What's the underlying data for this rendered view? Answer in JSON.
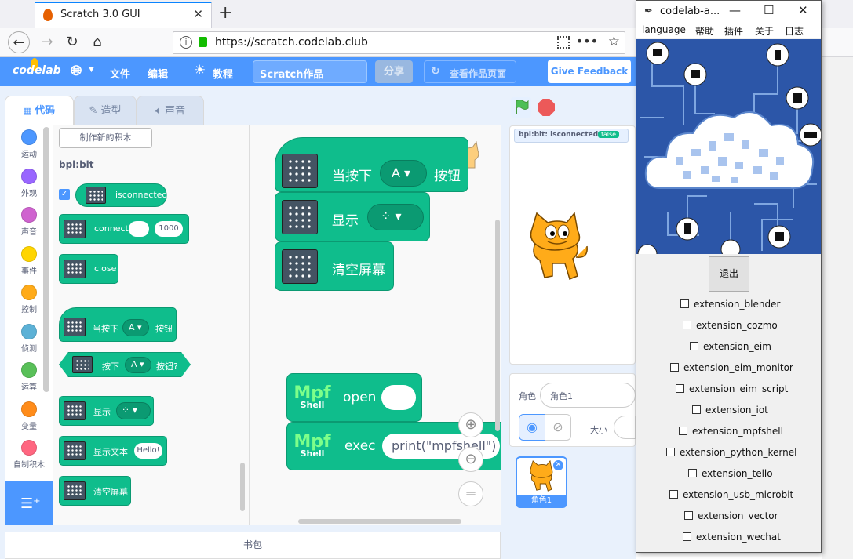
{
  "browser": {
    "tab_title": "Scratch 3.0 GUI",
    "tab_close": "✕",
    "new_tab": "+",
    "url": "https://scratch.codelab.club"
  },
  "menubar": {
    "logo": "codelab",
    "file": "文件",
    "edit": "编辑",
    "tutorials": "教程",
    "project_title": "Scratch作品",
    "share": "分享",
    "see_project": "查看作品页面",
    "feedback": "Give Feedback"
  },
  "editor_tabs": [
    "代码",
    "造型",
    "声音"
  ],
  "categories": [
    {
      "label": "运动",
      "color": "#4c97ff"
    },
    {
      "label": "外观",
      "color": "#9966ff"
    },
    {
      "label": "声音",
      "color": "#cf63cf"
    },
    {
      "label": "事件",
      "color": "#ffd500"
    },
    {
      "label": "控制",
      "color": "#ffab19"
    },
    {
      "label": "侦测",
      "color": "#5cb1d6"
    },
    {
      "label": "运算",
      "color": "#59c059"
    },
    {
      "label": "变量",
      "color": "#ff8c1a"
    },
    {
      "label": "自制积木",
      "color": "#ff6680"
    }
  ],
  "palette": {
    "make_block": "制作新的积木",
    "section": "bpi:bit",
    "isconnected": "isconnected",
    "connect": "connect",
    "connect_port": "1000",
    "close": "close",
    "when_pressed": "当按下",
    "when_pressed_key": "A",
    "button": "按钮",
    "pressed": "按下",
    "pressed_key": "A",
    "button_q": "按钮?",
    "show": "显示",
    "show_text": "显示文本",
    "show_text_value": "Hello!",
    "clear_screen": "清空屏幕"
  },
  "script": {
    "when_pressed": "当按下",
    "key": "A",
    "button": "按钮",
    "show": "显示",
    "clear_screen": "清空屏幕",
    "mpf": "Mpf",
    "shell": "Shell",
    "open": "open",
    "exec": "exec",
    "exec_value": "print(\"mpfshell\")"
  },
  "zoom": {
    "in": "⊕",
    "out": "⊖",
    "reset": "="
  },
  "backpack": "书包",
  "stage": {
    "monitor_label": "bpi:bit: isconnected",
    "monitor_value": "false"
  },
  "sprite": {
    "label": "角色",
    "name": "角色1",
    "size_label": "大小",
    "thumb_name": "角色1"
  },
  "popup": {
    "title": "codelab-a...",
    "menu": [
      "language",
      "帮助",
      "插件",
      "关于",
      "日志"
    ],
    "quit": "退出",
    "extensions": [
      "extension_blender",
      "extension_cozmo",
      "extension_eim",
      "extension_eim_monitor",
      "extension_eim_script",
      "extension_iot",
      "extension_mpfshell",
      "extension_python_kernel",
      "extension_tello",
      "extension_usb_microbit",
      "extension_vector",
      "extension_wechat"
    ]
  }
}
